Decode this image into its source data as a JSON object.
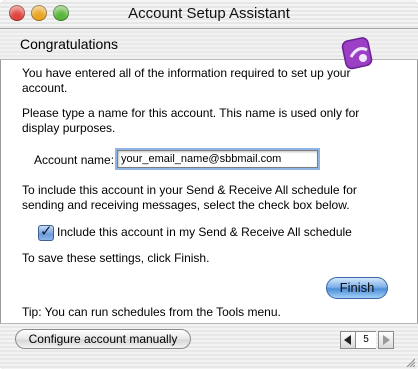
{
  "window": {
    "title": "Account Setup Assistant"
  },
  "header": {
    "heading": "Congratulations"
  },
  "icons": {
    "close": "close-button",
    "minimize": "minimize-button",
    "zoom": "zoom-button",
    "logo": "entourage-logo-icon",
    "prev": "triangle-left-icon",
    "next": "triangle-right-icon"
  },
  "body": {
    "intro": "You have entered all of the information required to set up your account.",
    "name_prompt": "Please type a name for this account. This name is used only for display purposes.",
    "account_name_label": "Account name:",
    "account_name_value": "your_email_name@sbbmail.com",
    "schedule_text": "To include this account in your Send & Receive All schedule for sending and receiving messages, select the check box below.",
    "checkbox_label": "Include this account in my Send & Receive All schedule",
    "checkbox_checked": true,
    "save_text": "To save these settings, click Finish.",
    "finish_label": "Finish",
    "tip": "Tip: You can run schedules from the Tools menu."
  },
  "footer": {
    "configure_label": "Configure account manually",
    "page_number": "5"
  },
  "colors": {
    "accent": "#5b93dc",
    "logo": "#9b3fc4"
  }
}
